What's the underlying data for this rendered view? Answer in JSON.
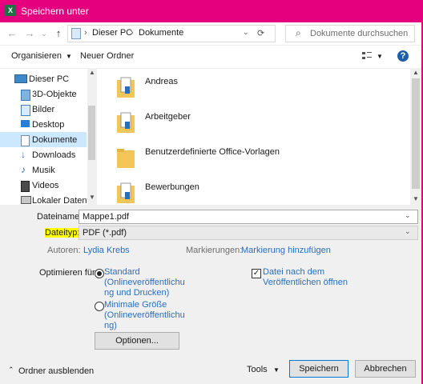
{
  "window": {
    "title": "Speichern unter",
    "app_icon": "X"
  },
  "address": {
    "breadcrumb": [
      "Dieser PC",
      "Dokumente"
    ],
    "search_placeholder": "Dokumente durchsuchen"
  },
  "toolbar": {
    "organize": "Organisieren",
    "new_folder": "Neuer Ordner"
  },
  "nav": {
    "items": [
      {
        "label": "Dieser PC",
        "icon": "pc-icon"
      },
      {
        "label": "3D-Objekte",
        "icon": "3d-objects-icon"
      },
      {
        "label": "Bilder",
        "icon": "pictures-icon"
      },
      {
        "label": "Desktop",
        "icon": "desktop-icon"
      },
      {
        "label": "Dokumente",
        "icon": "documents-icon",
        "selected": true
      },
      {
        "label": "Downloads",
        "icon": "downloads-icon"
      },
      {
        "label": "Musik",
        "icon": "music-icon"
      },
      {
        "label": "Videos",
        "icon": "videos-icon"
      },
      {
        "label": "Lokaler Datenträ",
        "icon": "drive-icon"
      }
    ]
  },
  "files": [
    {
      "name": "Andreas"
    },
    {
      "name": "Arbeitgeber"
    },
    {
      "name": "Benutzerdefinierte Office-Vorlagen"
    },
    {
      "name": "Bewerbungen"
    }
  ],
  "form": {
    "filename_label": "Dateiname:",
    "filename_value": "Mappe1.pdf",
    "filetype_label": "Dateityp:",
    "filetype_value": "PDF (*.pdf)",
    "authors_label": "Autoren:",
    "authors_value": "Lydia Krebs",
    "tags_label": "Markierungen:",
    "tags_value": "Markierung hinzufügen",
    "optimize_label": "Optimieren für:",
    "option_standard": [
      "Standard",
      "(Onlineveröffentlichu",
      "ng und Drucken)"
    ],
    "option_minimal": [
      "Minimale Größe",
      "(Onlineveröffentlichu",
      "ng)"
    ],
    "open_after_publish": [
      "Datei nach dem",
      "Veröffentlichen öffnen"
    ],
    "options_button": "Optionen..."
  },
  "footer": {
    "hide_folders": "Ordner ausblenden",
    "tools": "Tools",
    "save": "Speichern",
    "cancel": "Abbrechen"
  },
  "colors": {
    "titlebar": "#e5007e",
    "highlight": "#ffff00",
    "link": "#2a6ebb",
    "selection": "#cce8ff"
  }
}
